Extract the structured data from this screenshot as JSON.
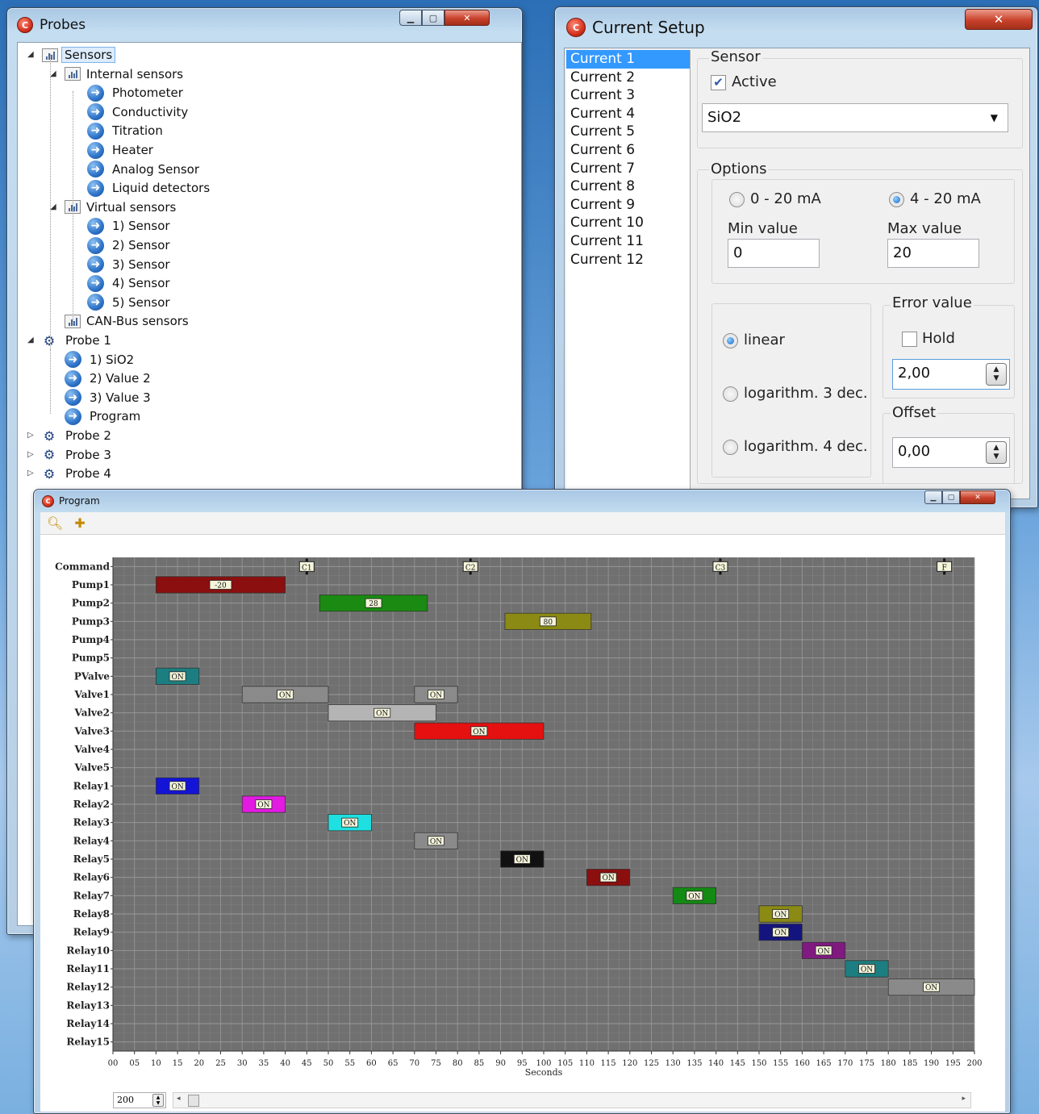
{
  "probes_window": {
    "title": "Probes",
    "tree": [
      {
        "label": "Sensors",
        "depth": 0,
        "icon": "chart",
        "expand": "open",
        "selected": true
      },
      {
        "label": "Internal sensors",
        "depth": 1,
        "icon": "chart",
        "expand": "open"
      },
      {
        "label": "Photometer",
        "depth": 2,
        "icon": "arrow"
      },
      {
        "label": "Conductivity",
        "depth": 2,
        "icon": "arrow"
      },
      {
        "label": "Titration",
        "depth": 2,
        "icon": "arrow"
      },
      {
        "label": "Heater",
        "depth": 2,
        "icon": "arrow"
      },
      {
        "label": "Analog Sensor",
        "depth": 2,
        "icon": "arrow"
      },
      {
        "label": "Liquid detectors",
        "depth": 2,
        "icon": "arrow"
      },
      {
        "label": "Virtual sensors",
        "depth": 1,
        "icon": "chart",
        "expand": "open"
      },
      {
        "label": "1) Sensor",
        "depth": 2,
        "icon": "arrow"
      },
      {
        "label": "2) Sensor",
        "depth": 2,
        "icon": "arrow"
      },
      {
        "label": "3) Sensor",
        "depth": 2,
        "icon": "arrow"
      },
      {
        "label": "4) Sensor",
        "depth": 2,
        "icon": "arrow"
      },
      {
        "label": "5) Sensor",
        "depth": 2,
        "icon": "arrow"
      },
      {
        "label": "CAN-Bus sensors",
        "depth": 1,
        "icon": "chart"
      },
      {
        "label": "Probe 1",
        "depth": 0,
        "icon": "probe",
        "expand": "open"
      },
      {
        "label": "1) SiO2",
        "depth": 1,
        "icon": "arrow"
      },
      {
        "label": "2) Value 2",
        "depth": 1,
        "icon": "arrow"
      },
      {
        "label": "3) Value 3",
        "depth": 1,
        "icon": "arrow"
      },
      {
        "label": "Program",
        "depth": 1,
        "icon": "arrow"
      },
      {
        "label": "Probe 2",
        "depth": 0,
        "icon": "probe",
        "expand": "closed"
      },
      {
        "label": "Probe 3",
        "depth": 0,
        "icon": "probe",
        "expand": "closed"
      },
      {
        "label": "Probe 4",
        "depth": 0,
        "icon": "probe",
        "expand": "closed"
      }
    ]
  },
  "setup_window": {
    "title": "Current Setup",
    "currents": [
      "Current 1",
      "Current 2",
      "Current 3",
      "Current 4",
      "Current 5",
      "Current 6",
      "Current 7",
      "Current 8",
      "Current 9",
      "Current 10",
      "Current 11",
      "Current 12"
    ],
    "selected_current": "Current 1",
    "sensor_group": "Sensor",
    "active_label": "Active",
    "active_checked": true,
    "sensor_value": "SiO2",
    "options_group": "Options",
    "range_0_20": "0 - 20 mA",
    "range_4_20": "4 - 20 mA",
    "range_selected": "4 - 20 mA",
    "min_label": "Min value",
    "min_value": "0",
    "max_label": "Max value",
    "max_value": "20",
    "scale_linear": "linear",
    "scale_log3": "logarithm. 3 dec.",
    "scale_log4": "logarithm. 4 dec.",
    "scale_selected": "linear",
    "error_group": "Error value",
    "hold_label": "Hold",
    "hold_checked": false,
    "error_value": "2,00",
    "offset_group": "Offset",
    "offset_value": "0,00"
  },
  "program_window": {
    "title": "Program",
    "toolbar": [
      "zoom-icon",
      "add-program-icon"
    ],
    "duration_value": "200",
    "colors": {
      "plot_bg": "#707070",
      "grid": "#9a9a9a"
    }
  },
  "chart_data": {
    "type": "gantt",
    "xlabel": "Seconds",
    "xlim": [
      0,
      200
    ],
    "x_ticks": [
      "00",
      "05",
      "10",
      "15",
      "20",
      "25",
      "30",
      "35",
      "40",
      "45",
      "50",
      "55",
      "60",
      "65",
      "70",
      "75",
      "80",
      "85",
      "90",
      "95",
      "100",
      "105",
      "110",
      "115",
      "120",
      "125",
      "130",
      "135",
      "140",
      "145",
      "150",
      "155",
      "160",
      "165",
      "170",
      "175",
      "180",
      "185",
      "190",
      "195",
      "200"
    ],
    "rows": [
      "Command",
      "Pump1",
      "Pump2",
      "Pump3",
      "Pump4",
      "Pump5",
      "PValve",
      "Valve1",
      "Valve2",
      "Valve3",
      "Valve4",
      "Valve5",
      "Relay1",
      "Relay2",
      "Relay3",
      "Relay4",
      "Relay5",
      "Relay6",
      "Relay7",
      "Relay8",
      "Relay9",
      "Relay10",
      "Relay11",
      "Relay12",
      "Relay13",
      "Relay14",
      "Relay15"
    ],
    "commands": [
      {
        "label": "C1",
        "t": 45
      },
      {
        "label": "C2",
        "t": 83
      },
      {
        "label": "C3",
        "t": 141
      },
      {
        "label": "F",
        "t": 193
      }
    ],
    "bars": [
      {
        "row": "Pump1",
        "start": 10,
        "end": 40,
        "label": "-20",
        "color": "#8b0f0f"
      },
      {
        "row": "Pump2",
        "start": 48,
        "end": 73,
        "label": "28",
        "color": "#1a8a12"
      },
      {
        "row": "Pump3",
        "start": 91,
        "end": 111,
        "label": "80",
        "color": "#8a8a14"
      },
      {
        "row": "PValve",
        "start": 10,
        "end": 20,
        "label": "ON",
        "color": "#1c7e80"
      },
      {
        "row": "Valve1",
        "start": 30,
        "end": 50,
        "label": "ON",
        "color": "#8a8a8a"
      },
      {
        "row": "Valve1",
        "start": 70,
        "end": 80,
        "label": "ON",
        "color": "#8a8a8a"
      },
      {
        "row": "Valve2",
        "start": 50,
        "end": 75,
        "label": "ON",
        "color": "#b4b4b4"
      },
      {
        "row": "Valve3",
        "start": 70,
        "end": 100,
        "label": "ON",
        "color": "#e51010"
      },
      {
        "row": "Relay1",
        "start": 10,
        "end": 20,
        "label": "ON",
        "color": "#1414d6"
      },
      {
        "row": "Relay2",
        "start": 30,
        "end": 40,
        "label": "ON",
        "color": "#e21ae2"
      },
      {
        "row": "Relay3",
        "start": 50,
        "end": 60,
        "label": "ON",
        "color": "#1fe0e0"
      },
      {
        "row": "Relay4",
        "start": 70,
        "end": 80,
        "label": "ON",
        "color": "#8a8a8a"
      },
      {
        "row": "Relay5",
        "start": 90,
        "end": 100,
        "label": "ON",
        "color": "#111111"
      },
      {
        "row": "Relay6",
        "start": 110,
        "end": 120,
        "label": "ON",
        "color": "#8b0f0f"
      },
      {
        "row": "Relay7",
        "start": 130,
        "end": 140,
        "label": "ON",
        "color": "#138a13"
      },
      {
        "row": "Relay8",
        "start": 150,
        "end": 160,
        "label": "ON",
        "color": "#8a8a14"
      },
      {
        "row": "Relay9",
        "start": 150,
        "end": 160,
        "label": "ON",
        "color": "#14147f"
      },
      {
        "row": "Relay10",
        "start": 160,
        "end": 170,
        "label": "ON",
        "color": "#801a80"
      },
      {
        "row": "Relay11",
        "start": 170,
        "end": 180,
        "label": "ON",
        "color": "#1c7e80"
      },
      {
        "row": "Relay12",
        "start": 180,
        "end": 200,
        "label": "ON",
        "color": "#8a8a8a"
      }
    ]
  }
}
